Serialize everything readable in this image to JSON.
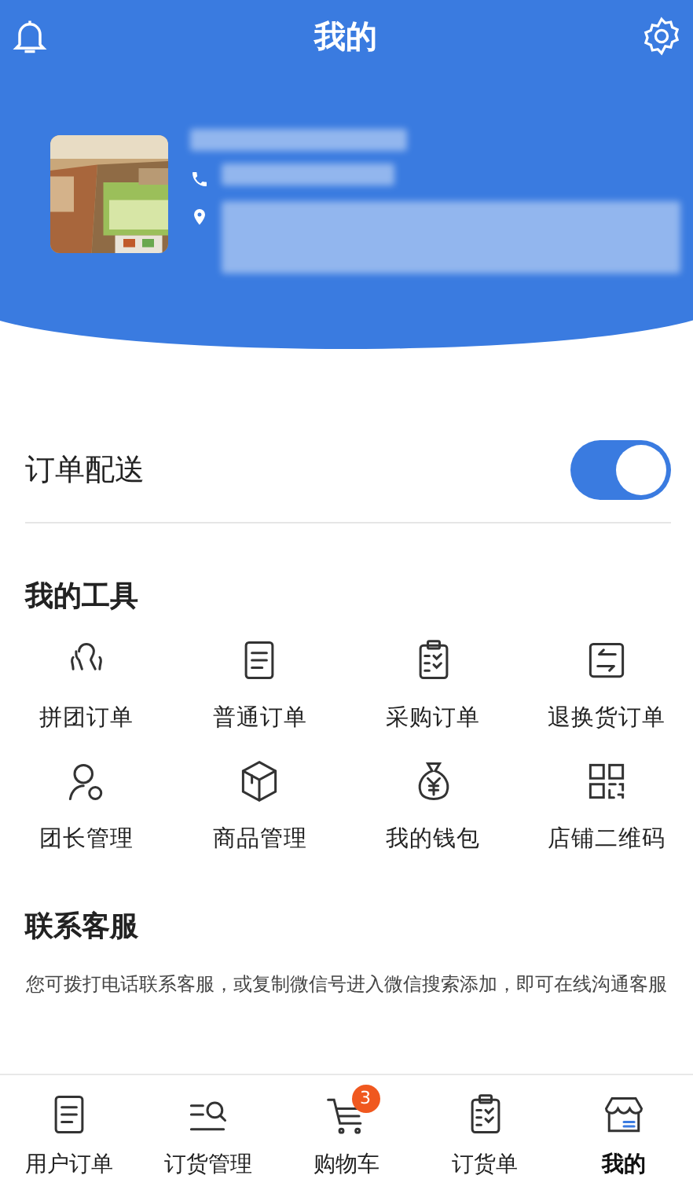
{
  "header": {
    "title": "我的"
  },
  "delivery": {
    "label": "订单配送",
    "on": true
  },
  "tools": {
    "title": "我的工具",
    "items": [
      {
        "label": "拼团订单"
      },
      {
        "label": "普通订单"
      },
      {
        "label": "采购订单"
      },
      {
        "label": "退换货订单"
      },
      {
        "label": "团长管理"
      },
      {
        "label": "商品管理"
      },
      {
        "label": "我的钱包"
      },
      {
        "label": "店铺二维码"
      }
    ]
  },
  "service": {
    "title": "联系客服",
    "text": "您可拨打电话联系客服，或复制微信号进入微信搜索添加，即可在线沟通客服"
  },
  "tab_bar": [
    {
      "label": "用户订单",
      "selected": false
    },
    {
      "label": "订货管理",
      "selected": false
    },
    {
      "label": "购物车",
      "selected": false,
      "badge": "3"
    },
    {
      "label": "订货单",
      "selected": false
    },
    {
      "label": "我的",
      "selected": true
    }
  ]
}
